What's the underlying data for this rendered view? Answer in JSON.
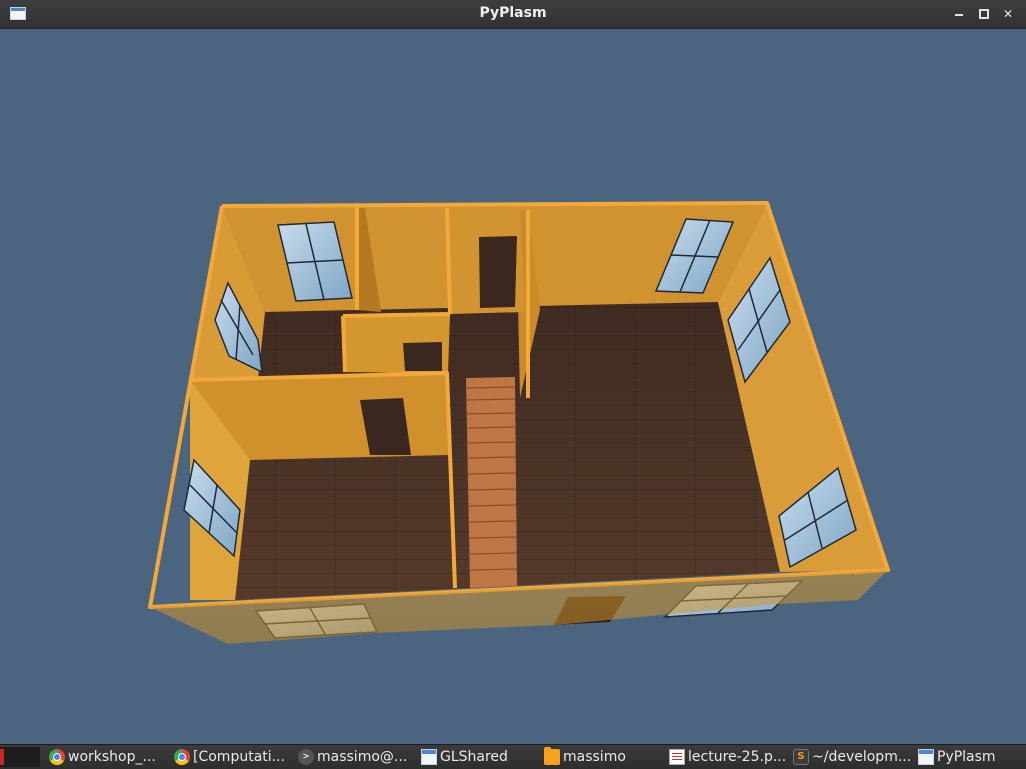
{
  "window": {
    "title": "PyPlasm",
    "controls": {
      "minimize": "minimize",
      "maximize": "maximize",
      "close": "close"
    }
  },
  "scene": {
    "description_icon": "3d-house-model",
    "colors": {
      "background": "#4b6580",
      "wall": "#d0922e",
      "wall_dark": "#a26d1c",
      "floor": "#4a3327",
      "window_glass": "#a7c4da",
      "door": "#3a2720",
      "stairs": "#c27746"
    }
  },
  "taskbar": {
    "items": [
      {
        "label": "workshop_...",
        "icon": "chrome-icon"
      },
      {
        "label": "[Computati...",
        "icon": "chrome-icon"
      },
      {
        "label": "massimo@...",
        "icon": "terminal-icon"
      },
      {
        "label": "GLShared",
        "icon": "window-icon"
      },
      {
        "label": "massimo",
        "icon": "folder-icon"
      },
      {
        "label": "lecture-25.p...",
        "icon": "document-icon"
      },
      {
        "label": "~/developm...",
        "icon": "sublime-icon"
      },
      {
        "label": "PyPlasm",
        "icon": "window-icon"
      }
    ]
  }
}
